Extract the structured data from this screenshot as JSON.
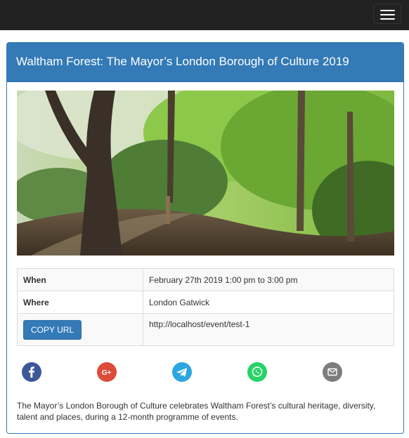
{
  "navbar": {
    "toggle_icon": "hamburger-menu-icon"
  },
  "event": {
    "title": "Waltham Forest: The Mayor’s London Borough of Culture 2019",
    "details": {
      "when_label": "When",
      "when_value": "February 27th 2019 1:00 pm to 3:00 pm",
      "where_label": "Where",
      "where_value": "London Gatwick",
      "copy_url_label": "COPY URL",
      "url_value": "http://localhost/event/test-1"
    },
    "share": [
      {
        "icon": "facebook-icon",
        "color": "#3b5998"
      },
      {
        "icon": "google-plus-icon",
        "color": "#dd4b39"
      },
      {
        "icon": "telegram-icon",
        "color": "#2ca5e0"
      },
      {
        "icon": "whatsapp-icon",
        "color": "#25d366"
      },
      {
        "icon": "email-icon",
        "color": "#7d7d7d"
      }
    ],
    "description": "The Mayor’s London Borough of Culture celebrates Waltham Forest’s cultural heritage, diversity, talent and places, during a 12-month programme of events."
  },
  "colors": {
    "navbar": "#222222",
    "panel_primary": "#337ab7",
    "table_border": "#dddddd"
  }
}
